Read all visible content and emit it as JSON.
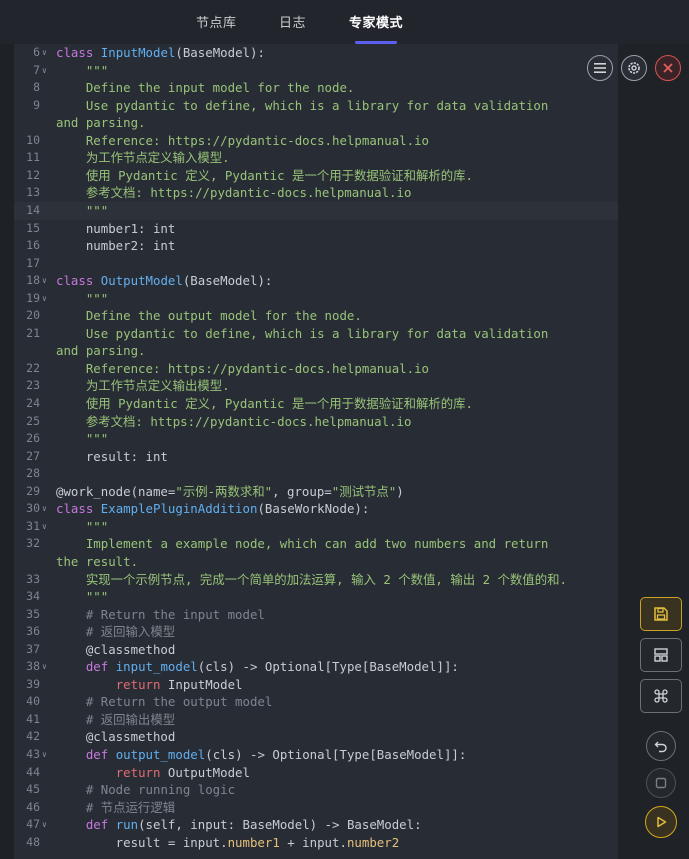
{
  "tabs": [
    {
      "label": "节点库",
      "active": false
    },
    {
      "label": "日志",
      "active": false
    },
    {
      "label": "专家模式",
      "active": true
    }
  ],
  "more_glyph": "⋮",
  "editor": {
    "active_line": 14,
    "lines": [
      {
        "n": 6,
        "fold": true,
        "html": "<span class='k'>class</span> <span class='c'>InputModel</span>(BaseModel):"
      },
      {
        "n": 7,
        "fold": true,
        "html": "    <span class='s'>\"\"\"</span>"
      },
      {
        "n": 8,
        "fold": false,
        "html": "    <span class='s'>Define the input model for the node.</span>"
      },
      {
        "n": 9,
        "fold": false,
        "html": "    <span class='s'>Use pydantic to define, which is a library for data validation</span>"
      },
      {
        "n": null,
        "fold": false,
        "html": "<span class='s'>and parsing.</span>"
      },
      {
        "n": 10,
        "fold": false,
        "html": "    <span class='s'>Reference: https://pydantic-docs.helpmanual.io</span>"
      },
      {
        "n": 11,
        "fold": false,
        "html": "    <span class='s'>为工作节点定义输入模型.</span>"
      },
      {
        "n": 12,
        "fold": false,
        "html": "    <span class='s'>使用 Pydantic 定义, Pydantic 是一个用于数据验证和解析的库.</span>"
      },
      {
        "n": 13,
        "fold": false,
        "html": "    <span class='s'>参考文档: https://pydantic-docs.helpmanual.io</span>"
      },
      {
        "n": 14,
        "fold": false,
        "html": "    <span class='s'>\"\"\"</span>"
      },
      {
        "n": 15,
        "fold": false,
        "html": "    number1: int"
      },
      {
        "n": 16,
        "fold": false,
        "html": "    number2: int"
      },
      {
        "n": 17,
        "fold": false,
        "html": ""
      },
      {
        "n": 18,
        "fold": true,
        "html": "<span class='k'>class</span> <span class='c'>OutputModel</span>(BaseModel):"
      },
      {
        "n": 19,
        "fold": true,
        "html": "    <span class='s'>\"\"\"</span>"
      },
      {
        "n": 20,
        "fold": false,
        "html": "    <span class='s'>Define the output model for the node.</span>"
      },
      {
        "n": 21,
        "fold": false,
        "html": "    <span class='s'>Use pydantic to define, which is a library for data validation</span>"
      },
      {
        "n": null,
        "fold": false,
        "html": "<span class='s'>and parsing.</span>"
      },
      {
        "n": 22,
        "fold": false,
        "html": "    <span class='s'>Reference: https://pydantic-docs.helpmanual.io</span>"
      },
      {
        "n": 23,
        "fold": false,
        "html": "    <span class='s'>为工作节点定义输出模型.</span>"
      },
      {
        "n": 24,
        "fold": false,
        "html": "    <span class='s'>使用 Pydantic 定义, Pydantic 是一个用于数据验证和解析的库.</span>"
      },
      {
        "n": 25,
        "fold": false,
        "html": "    <span class='s'>参考文档: https://pydantic-docs.helpmanual.io</span>"
      },
      {
        "n": 26,
        "fold": false,
        "html": "    <span class='s'>\"\"\"</span>"
      },
      {
        "n": 27,
        "fold": false,
        "html": "    result: int"
      },
      {
        "n": 28,
        "fold": false,
        "html": ""
      },
      {
        "n": 29,
        "fold": false,
        "html": "@work_node(name=<span class='s'>\"示例-两数求和\"</span>, group=<span class='s'>\"测试节点\"</span>)"
      },
      {
        "n": 30,
        "fold": true,
        "html": "<span class='k'>class</span> <span class='c'>ExamplePluginAddition</span>(BaseWorkNode):"
      },
      {
        "n": 31,
        "fold": true,
        "html": "    <span class='s'>\"\"\"</span>"
      },
      {
        "n": 32,
        "fold": false,
        "html": "    <span class='s'>Implement a example node, which can add two numbers and return</span>"
      },
      {
        "n": null,
        "fold": false,
        "html": "<span class='s'>the result.</span>"
      },
      {
        "n": 33,
        "fold": false,
        "html": "    <span class='s'>实现一个示例节点, 完成一个简单的加法运算, 输入 2 个数值, 输出 2 个数值的和.</span>"
      },
      {
        "n": 34,
        "fold": false,
        "html": "    <span class='s'>\"\"\"</span>"
      },
      {
        "n": 35,
        "fold": false,
        "html": "    <span class='cm'># Return the input model</span>"
      },
      {
        "n": 36,
        "fold": false,
        "html": "    <span class='cm'># 返回输入模型</span>"
      },
      {
        "n": 37,
        "fold": false,
        "html": "    @classmethod"
      },
      {
        "n": 38,
        "fold": true,
        "html": "    <span class='k'>def</span> <span class='c'>input_model</span>(cls) -> Optional[Type[BaseModel]]:"
      },
      {
        "n": 39,
        "fold": false,
        "html": "        <span class='kw'>return</span> InputModel"
      },
      {
        "n": 40,
        "fold": false,
        "html": "    <span class='cm'># Return the output model</span>"
      },
      {
        "n": 41,
        "fold": false,
        "html": "    <span class='cm'># 返回输出模型</span>"
      },
      {
        "n": 42,
        "fold": false,
        "html": "    @classmethod"
      },
      {
        "n": 43,
        "fold": true,
        "html": "    <span class='k'>def</span> <span class='c'>output_model</span>(cls) -> Optional[Type[BaseModel]]:"
      },
      {
        "n": 44,
        "fold": false,
        "html": "        <span class='kw'>return</span> OutputModel"
      },
      {
        "n": 45,
        "fold": false,
        "html": "    <span class='cm'># Node running logic</span>"
      },
      {
        "n": 46,
        "fold": false,
        "html": "    <span class='cm'># 节点运行逻辑</span>"
      },
      {
        "n": 47,
        "fold": true,
        "html": "    <span class='k'>def</span> <span class='c'>run</span>(self, input: BaseModel) -> BaseModel:"
      },
      {
        "n": 48,
        "fold": false,
        "html": "        result = input.<span class='o'>number1</span> + input.<span class='o'>number2</span>"
      }
    ]
  },
  "colors": {
    "keyword": "#c678dd",
    "class_name": "#61afef",
    "string": "#98c379",
    "comment": "#7f848e",
    "return_kw": "#e06c75",
    "attr": "#e5c07b",
    "accent": "#5b5ff0",
    "close_red": "#d9534f",
    "save_gold": "#c9a227",
    "run_gold": "#d4a81c"
  },
  "toolbar": {
    "menu_icon": "hamburger-menu-icon",
    "settings_icon": "gear-icon",
    "close_icon": "close-icon",
    "save_icon": "save-icon",
    "layout_icon": "layout-icon",
    "command_icon": "command-icon",
    "undo_icon": "undo-icon",
    "stop_icon": "stop-icon",
    "run_icon": "play-icon"
  }
}
